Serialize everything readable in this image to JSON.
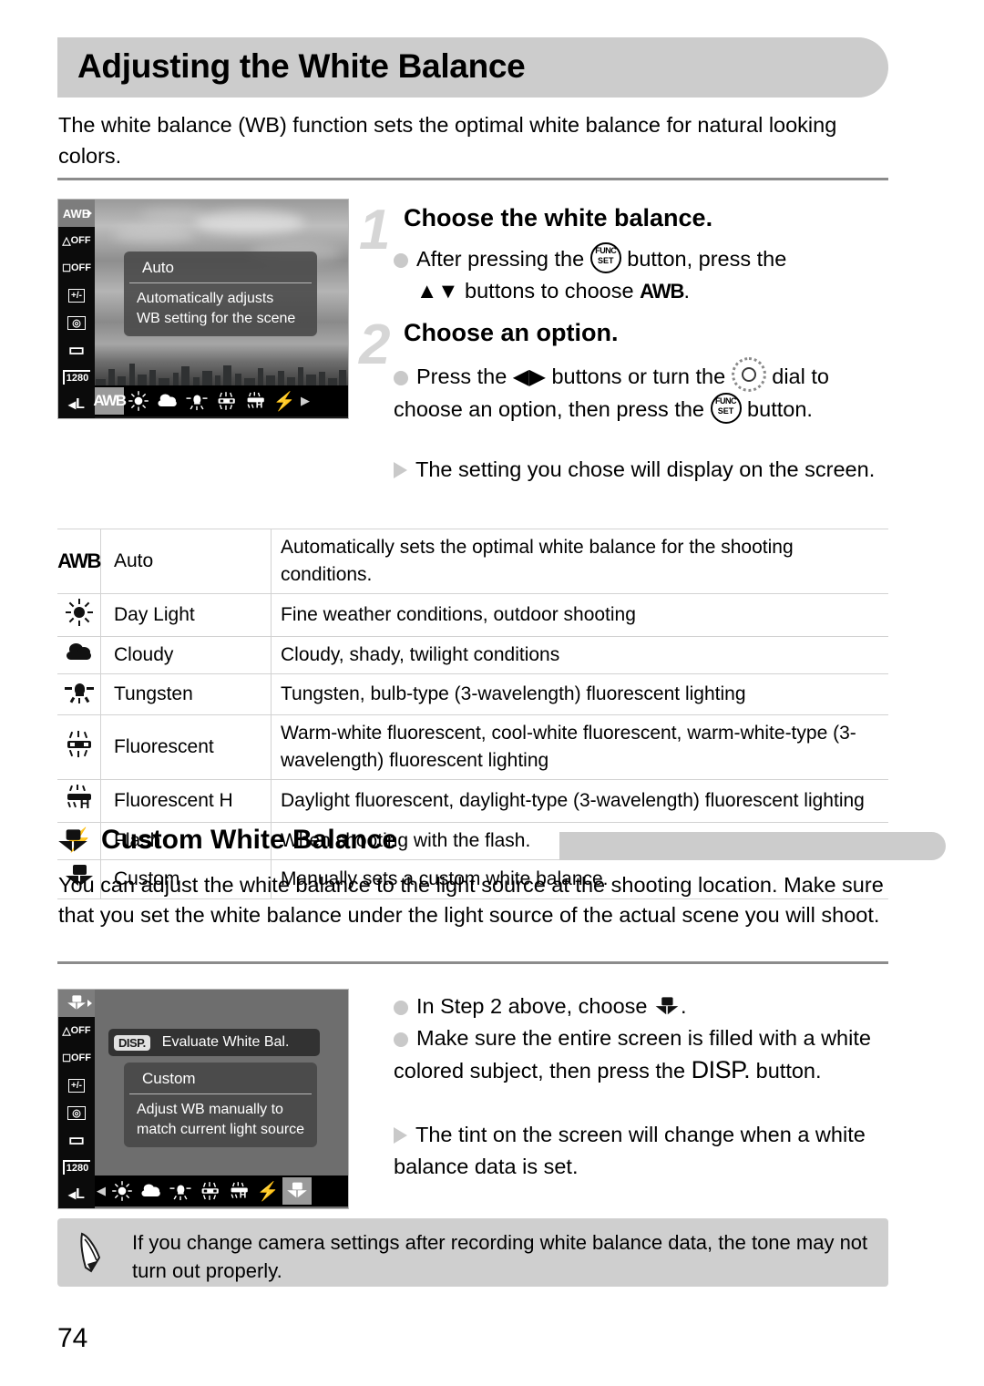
{
  "page": {
    "title": "Adjusting the White Balance",
    "intro": "The white balance (WB) function sets the optimal white balance for natural looking colors.",
    "page_number": "74"
  },
  "steps": [
    {
      "number": "1",
      "heading": "Choose the white balance.",
      "bullets": [
        {
          "marker": "dot",
          "pre": "After pressing the ",
          "icon": "func-set-button-icon",
          "mid": " button, press the ",
          "post_line": "▲▼ buttons to choose ",
          "icon2": "awb-icon",
          "tail": "."
        }
      ]
    },
    {
      "number": "2",
      "heading": "Choose an option.",
      "bullets": [
        {
          "marker": "dot",
          "pre": "Press the ◀▶ buttons or turn the ",
          "icon": "control-dial-icon",
          "mid": " dial to choose an option, then press the ",
          "icon2": "func-set-button-icon",
          "tail": " button."
        },
        {
          "marker": "triangle",
          "text": "The setting you chose will display on the screen."
        }
      ]
    }
  ],
  "screen1": {
    "rail": [
      {
        "label": "AWB",
        "selected": true,
        "name": "white-balance-rail-item"
      },
      {
        "label": "OFF",
        "selected": false,
        "name": "my-colors-rail-item"
      },
      {
        "label": "OFF",
        "selected": false,
        "name": "i-contrast-rail-item"
      },
      {
        "label": "+/-",
        "selected": false,
        "name": "flash-exposure-rail-item"
      },
      {
        "label": "◎",
        "selected": false,
        "name": "metering-rail-item"
      },
      {
        "label": "▭",
        "selected": false,
        "name": "drive-mode-rail-item"
      },
      {
        "label": "1280",
        "selected": false,
        "name": "movie-resolution-rail-item"
      },
      {
        "label": "L",
        "selected": false,
        "name": "image-size-rail-item"
      }
    ],
    "popup": {
      "title": "Auto",
      "desc_line1": "Automatically adjusts",
      "desc_line2": "WB setting for the scene"
    },
    "strip": [
      {
        "icon": "awb-icon",
        "label": "AWB",
        "selected": true
      },
      {
        "icon": "day-light-icon",
        "label": "",
        "selected": false
      },
      {
        "icon": "cloudy-icon",
        "label": "",
        "selected": false
      },
      {
        "icon": "tungsten-icon",
        "label": "",
        "selected": false
      },
      {
        "icon": "fluorescent-icon",
        "label": "",
        "selected": false
      },
      {
        "icon": "fluorescent-h-icon",
        "label": "",
        "selected": false
      },
      {
        "icon": "flash-icon",
        "label": "",
        "selected": false
      }
    ],
    "strip_arrow_right": "▶"
  },
  "screen2": {
    "rail": [
      {
        "label": "CUST",
        "selected": true,
        "name": "white-balance-rail-item"
      },
      {
        "label": "OFF",
        "selected": false,
        "name": "my-colors-rail-item"
      },
      {
        "label": "OFF",
        "selected": false,
        "name": "i-contrast-rail-item"
      },
      {
        "label": "+/-",
        "selected": false,
        "name": "flash-exposure-rail-item"
      },
      {
        "label": "◎",
        "selected": false,
        "name": "metering-rail-item"
      },
      {
        "label": "▭",
        "selected": false,
        "name": "drive-mode-rail-item"
      },
      {
        "label": "1280",
        "selected": false,
        "name": "movie-resolution-rail-item"
      },
      {
        "label": "L",
        "selected": false,
        "name": "image-size-rail-item"
      }
    ],
    "disp_badge": "DISP.",
    "disp_label": "Evaluate White Bal.",
    "popup": {
      "title": "Custom",
      "desc_line1": "Adjust WB manually to",
      "desc_line2": "match current light source"
    },
    "strip_arrow_left": "◀",
    "strip": [
      {
        "icon": "day-light-icon",
        "selected": false
      },
      {
        "icon": "cloudy-icon",
        "selected": false
      },
      {
        "icon": "tungsten-icon",
        "selected": false
      },
      {
        "icon": "fluorescent-icon",
        "selected": false
      },
      {
        "icon": "fluorescent-h-icon",
        "selected": false
      },
      {
        "icon": "flash-icon",
        "selected": false
      },
      {
        "icon": "custom-icon",
        "selected": true
      }
    ]
  },
  "table": {
    "rows": [
      {
        "icon": "awb-icon",
        "name": "Auto",
        "desc": "Automatically sets the optimal white balance for the shooting conditions."
      },
      {
        "icon": "day-light-icon",
        "name": "Day Light",
        "desc": "Fine weather conditions, outdoor shooting"
      },
      {
        "icon": "cloudy-icon",
        "name": "Cloudy",
        "desc": "Cloudy, shady, twilight conditions"
      },
      {
        "icon": "tungsten-icon",
        "name": "Tungsten",
        "desc": "Tungsten, bulb-type (3-wavelength) fluorescent lighting"
      },
      {
        "icon": "fluorescent-icon",
        "name": "Fluorescent",
        "desc": "Warm-white fluorescent, cool-white fluorescent, warm-white-type (3-wavelength) fluorescent lighting"
      },
      {
        "icon": "fluorescent-h-icon",
        "name": "Fluorescent H",
        "desc": "Daylight fluorescent, daylight-type (3-wavelength) fluorescent lighting"
      },
      {
        "icon": "flash-icon",
        "name": "Flash",
        "desc": "When shooting with the flash."
      },
      {
        "icon": "custom-icon",
        "name": "Custom",
        "desc": "Manually sets a custom white balance."
      }
    ]
  },
  "section2": {
    "icon": "custom-icon",
    "title": "Custom White Balance",
    "paragraph": "You can adjust the white balance to the light source at the shooting location. Make sure that you set the white balance under the light source of the actual scene you will shoot.",
    "bullets": [
      {
        "marker": "dot",
        "pre": "In Step 2 above, choose ",
        "icon": "custom-icon",
        "tail": "."
      },
      {
        "marker": "dot",
        "pre": "Make sure the entire screen is filled with a white colored subject, then press the ",
        "icon": "disp-text-icon",
        "tail": " button."
      },
      {
        "marker": "triangle",
        "text": "The tint on the screen will change when a white balance data is set."
      }
    ]
  },
  "note": {
    "icon": "pencil-icon",
    "text": "If you change camera settings after recording white balance data, the tone may not turn out properly."
  },
  "colors": {
    "title_bar": "#cccccc",
    "rule": "#8c8c8c",
    "bullet": "#c9c9c9",
    "step_number": "#d6d6d6",
    "note_bg": "#cfcfcf",
    "table_border": "#d2d2d2"
  }
}
